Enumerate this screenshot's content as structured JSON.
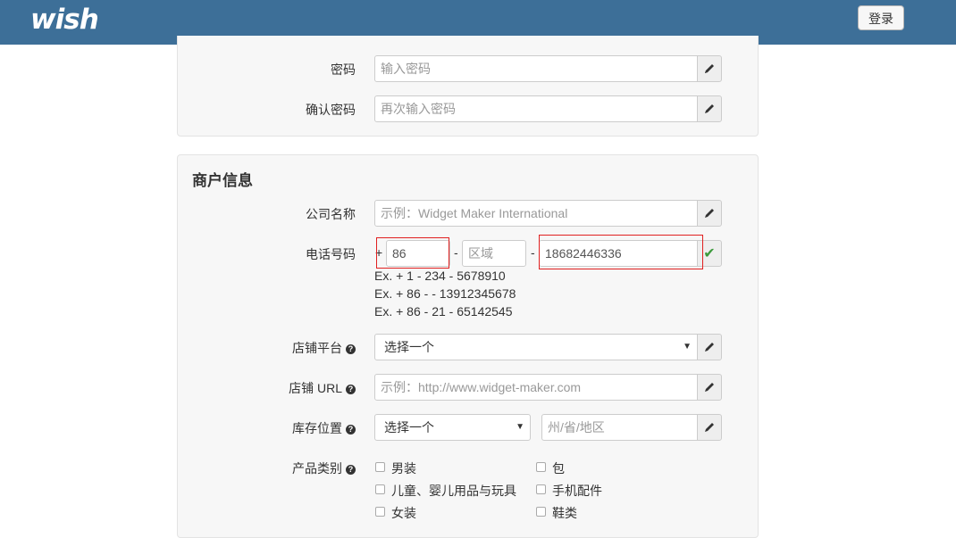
{
  "header": {
    "logo": "wish",
    "login_label": "登录",
    "bg": "#3d6f98"
  },
  "account": {
    "password": {
      "label": "密码",
      "placeholder": "输入密码"
    },
    "confirm": {
      "label": "确认密码",
      "placeholder": "再次输入密码"
    }
  },
  "merchant": {
    "title": "商户信息",
    "company": {
      "label": "公司名称",
      "placeholder": "示例：Widget Maker International"
    },
    "phone": {
      "label": "电话号码",
      "plus": "+",
      "country_code": "86",
      "sep1": "-",
      "area_placeholder": "区域",
      "sep2": "-",
      "number": "18682446336",
      "valid_icon": "✔",
      "examples": [
        "Ex. + 1 - 234 - 5678910",
        "Ex. + 86 - - 13912345678",
        "Ex. + 86 - 21 - 65142545"
      ]
    },
    "platform": {
      "label": "店铺平台",
      "value": "选择一个"
    },
    "url": {
      "label": "店铺 URL",
      "placeholder": "示例：http://www.widget-maker.com"
    },
    "warehouse": {
      "label": "库存位置",
      "value": "选择一个",
      "region_placeholder": "州/省/地区"
    },
    "categories": {
      "label": "产品类别",
      "items": [
        "男装",
        "包",
        "儿童、婴儿用品与玩具",
        "手机配件",
        "女装",
        "鞋类"
      ]
    }
  },
  "icons": {
    "edit": "pencil-icon",
    "help": "question-circle-icon",
    "valid": "check-icon"
  },
  "colors": {
    "valid": "#3c9a3c",
    "highlight": "#e02020"
  }
}
